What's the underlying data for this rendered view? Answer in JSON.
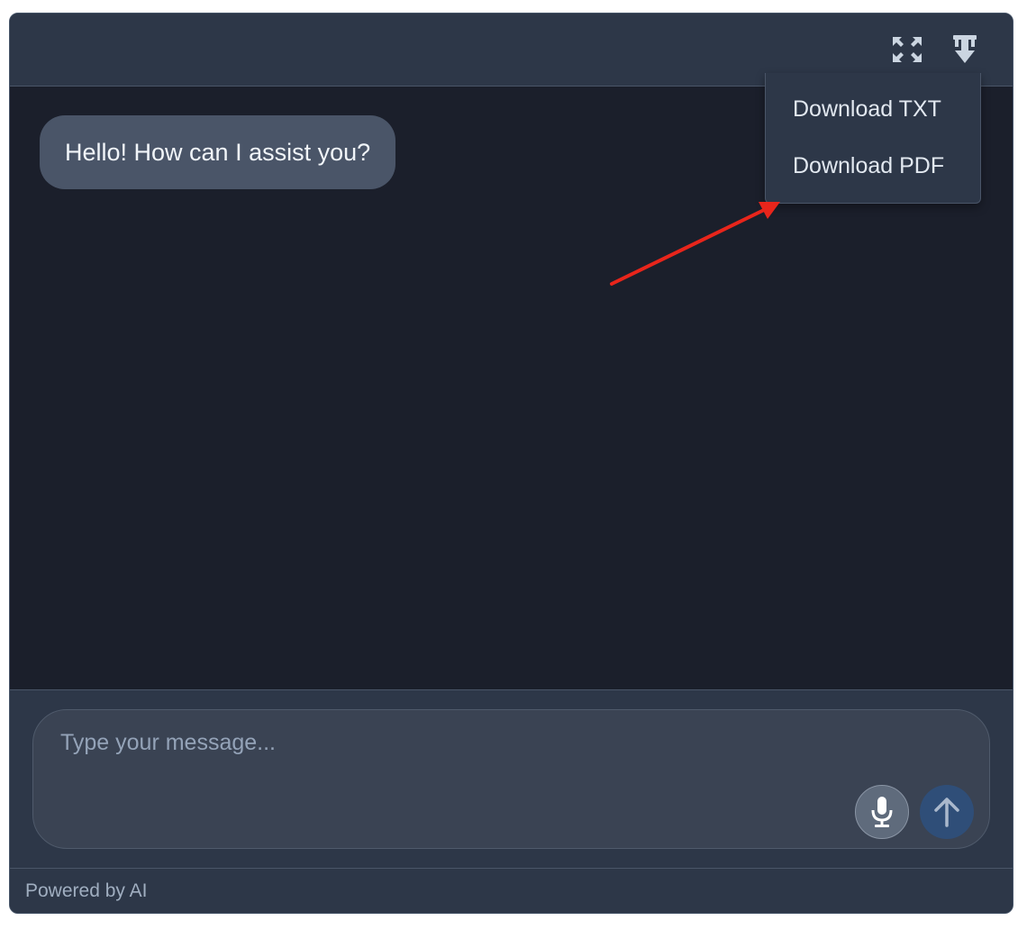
{
  "header": {
    "expand_icon": "expand-icon",
    "download_icon": "download-icon"
  },
  "chat": {
    "messages": [
      {
        "role": "assistant",
        "text": "Hello! How can I assist you?"
      }
    ]
  },
  "download_menu": {
    "items": [
      {
        "label": "Download TXT"
      },
      {
        "label": "Download PDF"
      }
    ]
  },
  "input": {
    "value": "",
    "placeholder": "Type your message...",
    "mic_icon": "microphone-icon",
    "send_icon": "arrow-up-icon"
  },
  "footer": {
    "text": "Powered by AI"
  },
  "colors": {
    "panel": "#2d3748",
    "chat_bg": "#1b1f2b",
    "bubble": "#4a5568",
    "send_button": "#2f4e78",
    "annotation_arrow": "#e8251b"
  }
}
